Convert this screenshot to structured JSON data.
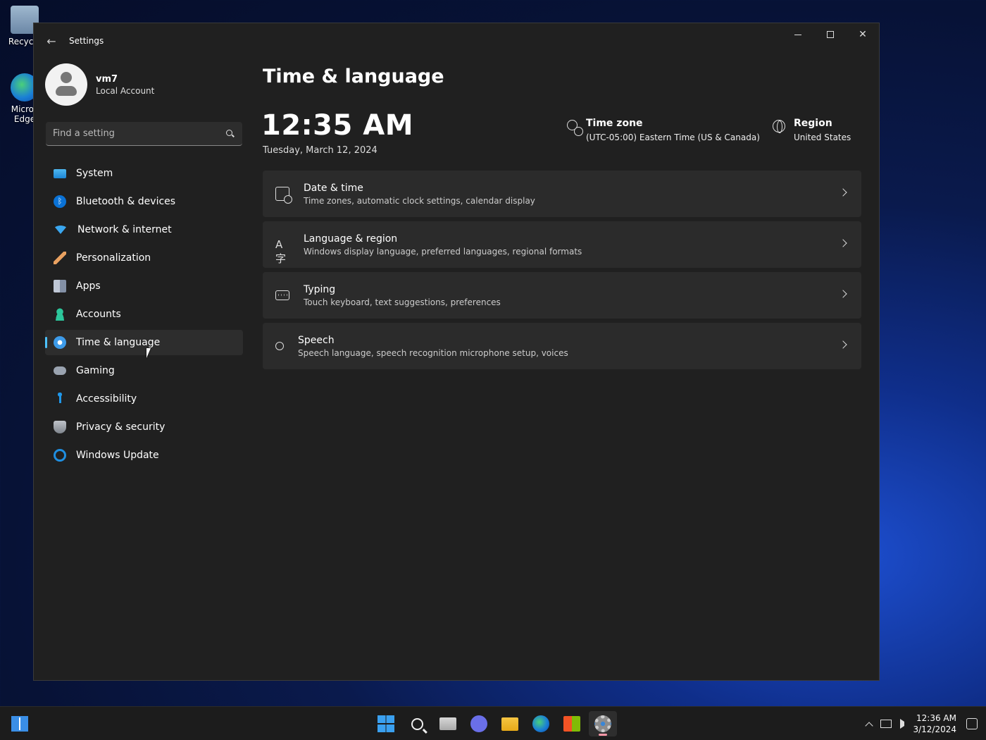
{
  "desktop": {
    "icons": [
      {
        "label": "Recycle"
      },
      {
        "label": "Micros Edge"
      }
    ]
  },
  "window": {
    "title": "Settings",
    "controls": {
      "minimize": "minimize",
      "maximize": "maximize",
      "close": "close"
    }
  },
  "profile": {
    "name": "vm7",
    "account_type": "Local Account"
  },
  "search": {
    "placeholder": "Find a setting",
    "value": ""
  },
  "sidebar": {
    "items": [
      {
        "label": "System",
        "icon": "system-icon"
      },
      {
        "label": "Bluetooth & devices",
        "icon": "bluetooth-icon"
      },
      {
        "label": "Network & internet",
        "icon": "network-icon"
      },
      {
        "label": "Personalization",
        "icon": "brush-icon"
      },
      {
        "label": "Apps",
        "icon": "apps-icon"
      },
      {
        "label": "Accounts",
        "icon": "person-icon"
      },
      {
        "label": "Time & language",
        "icon": "clock-globe-icon",
        "selected": true
      },
      {
        "label": "Gaming",
        "icon": "gamepad-icon"
      },
      {
        "label": "Accessibility",
        "icon": "accessibility-icon"
      },
      {
        "label": "Privacy & security",
        "icon": "shield-icon"
      },
      {
        "label": "Windows Update",
        "icon": "update-icon"
      }
    ],
    "accent_color": "#4cc2ff"
  },
  "main": {
    "title": "Time & language",
    "time": "12:35 AM",
    "date": "Tuesday, March 12, 2024",
    "time_zone": {
      "title": "Time zone",
      "value": "(UTC-05:00) Eastern Time (US & Canada)"
    },
    "region": {
      "title": "Region",
      "value": "United States"
    },
    "cards": [
      {
        "title": "Date & time",
        "desc": "Time zones, automatic clock settings, calendar display"
      },
      {
        "title": "Language & region",
        "desc": "Windows display language, preferred languages, regional formats"
      },
      {
        "title": "Typing",
        "desc": "Touch keyboard, text suggestions, preferences"
      },
      {
        "title": "Speech",
        "desc": "Speech language, speech recognition microphone setup, voices"
      }
    ]
  },
  "taskbar": {
    "apps": [
      "start-icon",
      "search-icon",
      "task-view-icon",
      "chat-icon",
      "file-explorer-icon",
      "edge-icon",
      "store-icon",
      "settings-icon"
    ],
    "active_app": "settings-icon",
    "clock_time": "12:36 AM",
    "clock_date": "3/12/2024"
  }
}
